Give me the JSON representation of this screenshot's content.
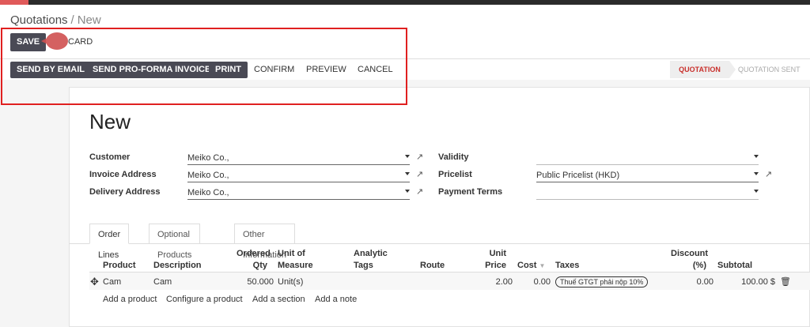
{
  "breadcrumb": {
    "parent": "Quotations",
    "separator": "/",
    "current": "New"
  },
  "toolbar": {
    "save": "SAVE",
    "discard": "CARD"
  },
  "actions": {
    "send_email": "SEND BY EMAIL",
    "send_proforma": "SEND PRO-FORMA INVOICE",
    "print": "PRINT",
    "confirm": "CONFIRM",
    "preview": "PREVIEW",
    "cancel": "CANCEL"
  },
  "status": {
    "current": "QUOTATION",
    "next": "QUOTATION SENT"
  },
  "form": {
    "title": "New",
    "customer_label": "Customer",
    "customer_value": "Meiko Co.,",
    "invoice_label": "Invoice Address",
    "invoice_value": "Meiko Co.,",
    "delivery_label": "Delivery Address",
    "delivery_value": "Meiko Co.,",
    "validity_label": "Validity",
    "validity_value": "",
    "pricelist_label": "Pricelist",
    "pricelist_value": "Public Pricelist (HKD)",
    "payment_label": "Payment Terms",
    "payment_value": ""
  },
  "tabs": [
    "Order Lines",
    "Optional Products",
    "Other Information"
  ],
  "columns": {
    "product": "Product",
    "description": "Description",
    "qty1": "Ordered",
    "qty2": "Qty",
    "uom1": "Unit of",
    "uom2": "Measure",
    "tags1": "Analytic",
    "tags2": "Tags",
    "route": "Route",
    "price1": "Unit",
    "price2": "Price",
    "cost": "Cost",
    "taxes": "Taxes",
    "disc1": "Discount",
    "disc2": "(%)",
    "subtotal": "Subtotal"
  },
  "line": {
    "product": "Cam",
    "description": "Cam",
    "qty": "50.000",
    "uom": "Unit(s)",
    "price": "2.00",
    "cost": "0.00",
    "tax": "Thuế GTGT phải nộp 10%",
    "discount": "0.00",
    "subtotal": "100.00 $"
  },
  "add_links": {
    "product": "Add a product",
    "configure": "Configure a product",
    "section": "Add a section",
    "note": "Add a note"
  },
  "icons": {
    "external": "external-link-icon",
    "move": "move-handle-icon",
    "delete": "trash-icon",
    "caret": "caret-down-icon"
  },
  "colors": {
    "accent": "#e05a5a",
    "button_dark": "#4a4a55",
    "status_active": "#c9302c"
  }
}
